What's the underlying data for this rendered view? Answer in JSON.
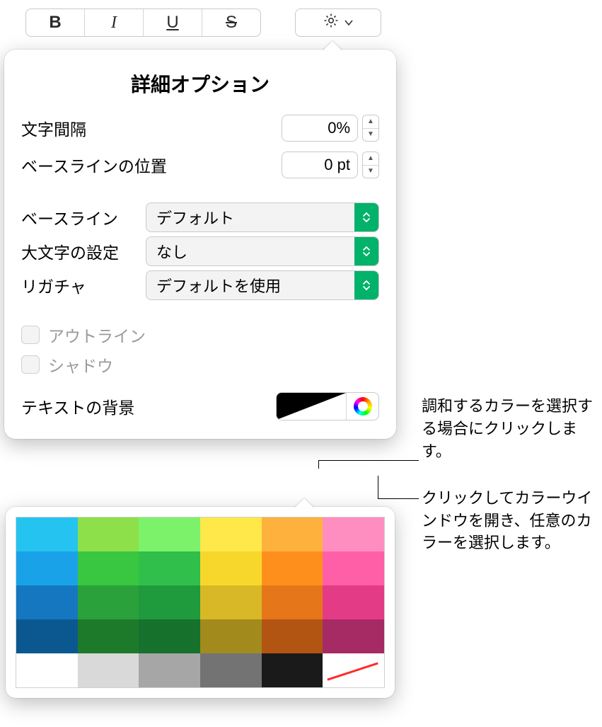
{
  "toolbar": {
    "bold": "B",
    "italic": "I",
    "underline": "U",
    "strike": "S"
  },
  "popover": {
    "title": "詳細オプション",
    "char_spacing_label": "文字間隔",
    "char_spacing_value": "0%",
    "baseline_shift_label": "ベースラインの位置",
    "baseline_shift_value": "0 pt",
    "baseline_label": "ベースライン",
    "baseline_value": "デフォルト",
    "caps_label": "大文字の設定",
    "caps_value": "なし",
    "ligature_label": "リガチャ",
    "ligature_value": "デフォルトを使用",
    "outline_label": "アウトライン",
    "shadow_label": "シャドウ",
    "textbg_label": "テキストの背景"
  },
  "callouts": {
    "swatch": "調和するカラーを選択する場合にクリックします。",
    "wheel": "クリックしてカラーウインドウを開き、任意のカラーを選択します。"
  },
  "palette": {
    "rows": [
      [
        "#24c3f0",
        "#8de04a",
        "#7cf26a",
        "#ffe84a",
        "#ffb13d",
        "#ff8ec0"
      ],
      [
        "#1aa2e8",
        "#39c641",
        "#2fbf4a",
        "#f7d72b",
        "#ff8f1c",
        "#ff5fa7"
      ],
      [
        "#1477c0",
        "#2aa13a",
        "#1f9a3d",
        "#d8b826",
        "#e6761a",
        "#e43b86"
      ],
      [
        "#0b5890",
        "#1e7a2b",
        "#16712c",
        "#a38a1d",
        "#b25513",
        "#a62a63"
      ]
    ],
    "grays": [
      "#ffffff",
      "#d9d9d9",
      "#a6a6a6",
      "#737373",
      "#1a1a1a"
    ],
    "none_label": "no-color"
  }
}
